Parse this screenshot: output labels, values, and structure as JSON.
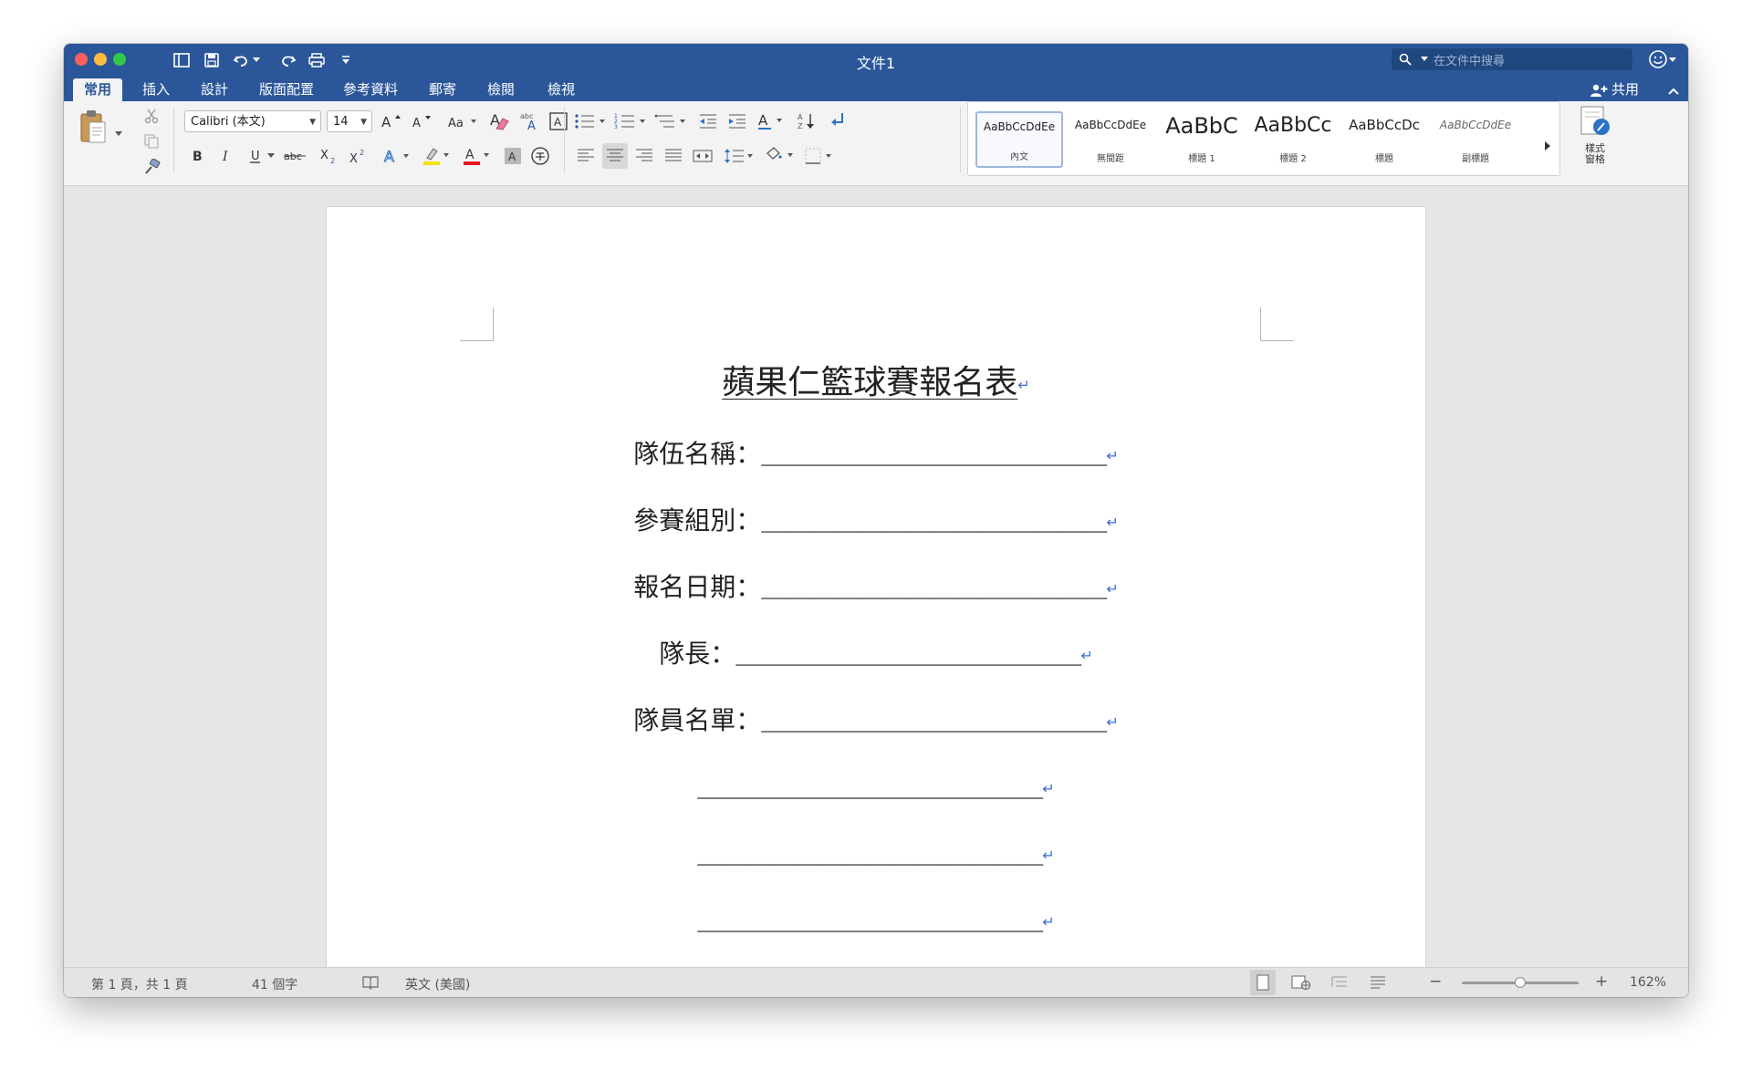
{
  "window": {
    "title": "文件1",
    "search_placeholder": "在文件中搜尋"
  },
  "tabs": [
    {
      "label": "常用",
      "active": true
    },
    {
      "label": "插入"
    },
    {
      "label": "設計"
    },
    {
      "label": "版面配置"
    },
    {
      "label": "參考資料"
    },
    {
      "label": "郵寄"
    },
    {
      "label": "檢閱"
    },
    {
      "label": "檢視"
    }
  ],
  "share_label": "共用",
  "ribbon": {
    "paste_label": "貼上",
    "font_name": "Calibri (本文)",
    "font_size": "14",
    "styles": [
      {
        "preview": "AaBbCcDdEe",
        "name": "內文",
        "selected": true
      },
      {
        "preview": "AaBbCcDdEe",
        "name": "無間距"
      },
      {
        "preview": "AaBbC",
        "name": "標題 1"
      },
      {
        "preview": "AaBbCc",
        "name": "標題 2"
      },
      {
        "preview": "AaBbCcDc",
        "name": "標題"
      },
      {
        "preview": "AaBbCcDdEe",
        "name": "副標題"
      }
    ],
    "styles_pane_label": "樣式窗格",
    "colors": {
      "highlight": "#f5e200",
      "font_color": "#e81123"
    }
  },
  "document": {
    "title": "蘋果仁籃球賽報名表",
    "fields": [
      {
        "label": "隊伍名稱：",
        "blank": "＿＿＿＿＿＿＿＿＿＿＿＿＿＿"
      },
      {
        "label": "參賽組別：",
        "blank": "＿＿＿＿＿＿＿＿＿＿＿＿＿＿"
      },
      {
        "label": "報名日期：",
        "blank": "＿＿＿＿＿＿＿＿＿＿＿＿＿＿"
      },
      {
        "label": "隊長：",
        "blank": "＿＿＿＿＿＿＿＿＿＿＿＿＿＿"
      },
      {
        "label": "隊員名單：",
        "blank": "＿＿＿＿＿＿＿＿＿＿＿＿＿＿"
      },
      {
        "label": "",
        "blank": "＿＿＿＿＿＿＿＿＿＿＿＿＿＿"
      },
      {
        "label": "",
        "blank": "＿＿＿＿＿＿＿＿＿＿＿＿＿＿"
      },
      {
        "label": "",
        "blank": "＿＿＿＿＿＿＿＿＿＿＿＿＿＿"
      }
    ],
    "paragraph_mark": "↵"
  },
  "status": {
    "page": "第 1 頁，共 1 頁",
    "words": "41 個字",
    "language": "英文 (美國)",
    "zoom_minus": "−",
    "zoom_plus": "+",
    "zoom": "162%",
    "zoom_fraction": 0.5
  }
}
